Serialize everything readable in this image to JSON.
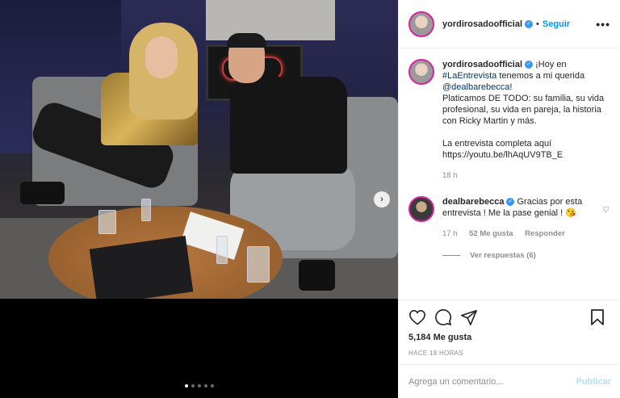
{
  "post": {
    "username": "yordirosadoofficial",
    "follow_label": "Seguir",
    "more_label": "•••",
    "caption_parts": {
      "prefix": "¡Hoy en ",
      "hashtag": "#LaEntrevista",
      "middle": " tenemos a mi querida ",
      "mention": "@dealbarebecca",
      "suffix": "!",
      "line2": "Platicamos DE TODO: su familia, su vida profesional, su vida en pareja, la historia con Ricky Martin y más.",
      "line3": "La entrevista completa aquí https://youtu.be/lhAqUV9TB_E"
    },
    "caption_time": "18 h",
    "likes": "5,184 Me gusta",
    "posted_ago": "HACE 18 HORAS"
  },
  "comment": {
    "username": "dealbarebecca",
    "text": "Gracias por esta entrevista ! Me la pase genial ! 😘",
    "time": "17 h",
    "likes": "52 Me gusta",
    "reply_label": "Responder",
    "view_replies": "Ver respuestas (6)"
  },
  "composer": {
    "placeholder": "Agrega un comentario...",
    "publish_label": "Publicar"
  },
  "carousel": {
    "next_icon": "chevron-right-icon",
    "dots": 5,
    "active_dot": 0
  },
  "colors": {
    "link_blue": "#0095f6",
    "verified_blue": "#3897f0",
    "publish_disabled": "#b2dffc",
    "muted": "#8e8e8e"
  }
}
